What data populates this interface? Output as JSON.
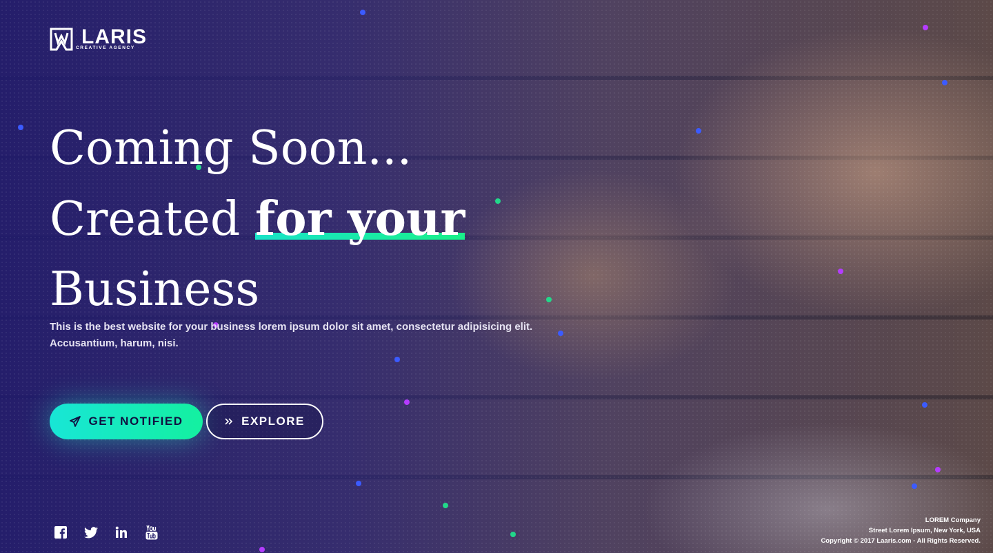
{
  "brand": {
    "name": "LARIS",
    "tagline": "CREATIVE AGENCY"
  },
  "hero": {
    "headline_line1": "Coming Soon...",
    "headline_line2_prefix": "Created ",
    "headline_highlight": "for your",
    "headline_line3": "Business",
    "description_line1": "This is the best website for your business lorem ipsum dolor sit amet, consectetur adipisicing elit.",
    "description_line2": "Accusantium, harum, nisi."
  },
  "buttons": {
    "primary_label": "GET NOTIFIED",
    "primary_icon": "paper-plane-icon",
    "secondary_label": "EXPLORE",
    "secondary_icon": "double-chevron-right-icon"
  },
  "social": [
    {
      "name": "facebook",
      "icon": "facebook-icon"
    },
    {
      "name": "twitter",
      "icon": "twitter-icon"
    },
    {
      "name": "linkedin",
      "icon": "linkedin-icon"
    },
    {
      "name": "youtube",
      "icon": "youtube-icon"
    }
  ],
  "footer": {
    "company": "LOREM Company",
    "address": "Street Lorem Ipsum, New York, USA",
    "copyright": "Copyright © 2017 Laaris.com - All Rights Reserved."
  },
  "colors": {
    "accent_start": "#18e6d6",
    "accent_end": "#14f0a0",
    "overlay": "#201a6e",
    "text": "#ffffff"
  }
}
